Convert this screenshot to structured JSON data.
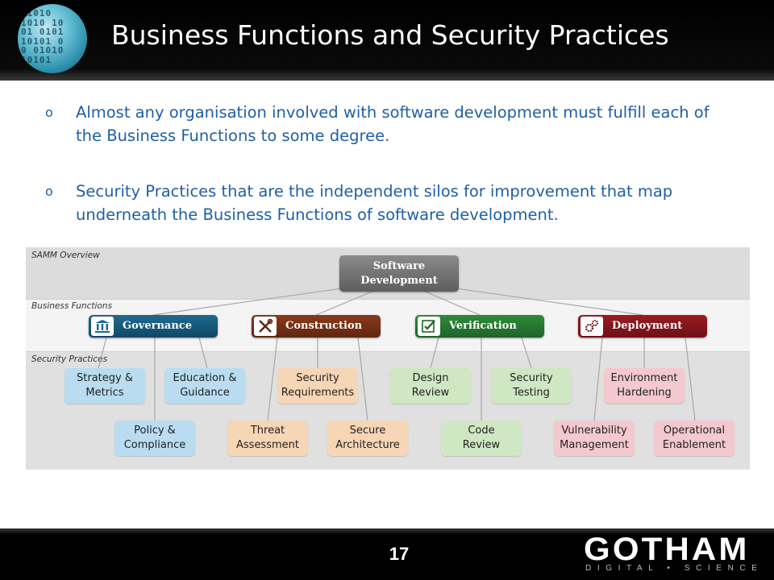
{
  "slide": {
    "title": "Business Functions and Security Practices",
    "page_number": "17"
  },
  "bullets": [
    {
      "marker": "o",
      "text": "Almost any organisation involved with software development must fulfill each of the Business Functions to some degree."
    },
    {
      "marker": "o",
      "text": "Security Practices that are the independent silos for improvement that map underneath the Business Functions of software development."
    }
  ],
  "samm": {
    "sections": {
      "overview": "SAMM Overview",
      "functions": "Business Functions",
      "practices": "Security Practices"
    },
    "root": {
      "line1": "Software",
      "line2": "Development"
    },
    "functions": [
      {
        "label": "Governance",
        "icon": "building-icon",
        "color": "#1f6a8e"
      },
      {
        "label": "Construction",
        "icon": "tools-icon",
        "color": "#8a3a1a"
      },
      {
        "label": "Verification",
        "icon": "checklist-icon",
        "color": "#2f8a3a"
      },
      {
        "label": "Deployment",
        "icon": "gears-icon",
        "color": "#9a1b22"
      }
    ],
    "practices": {
      "governance": [
        {
          "line1": "Strategy &",
          "line2": "Metrics"
        },
        {
          "line1": "Education &",
          "line2": "Guidance"
        },
        {
          "line1": "Policy &",
          "line2": "Compliance"
        }
      ],
      "construction": [
        {
          "line1": "Security",
          "line2": "Requirements"
        },
        {
          "line1": "Threat",
          "line2": "Assessment"
        },
        {
          "line1": "Secure",
          "line2": "Architecture"
        }
      ],
      "verification": [
        {
          "line1": "Design",
          "line2": "Review"
        },
        {
          "line1": "Security",
          "line2": "Testing"
        },
        {
          "line1": "Code",
          "line2": "Review"
        }
      ],
      "deployment": [
        {
          "line1": "Environment",
          "line2": "Hardening"
        },
        {
          "line1": "Vulnerability",
          "line2": "Management"
        },
        {
          "line1": "Operational",
          "line2": "Enablement"
        }
      ]
    }
  },
  "logo": {
    "main": "GOTHAM",
    "sub": "DIGITAL • SCIENCE"
  },
  "colors": {
    "bullet_text": "#1f5fa6",
    "practice_blue": "#b9dcf0",
    "practice_orange": "#f7d6b5",
    "practice_green": "#cfe7c2",
    "practice_pink": "#f3c8cf"
  }
}
